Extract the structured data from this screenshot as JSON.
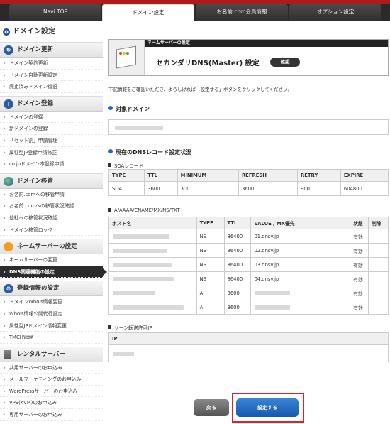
{
  "tabs": [
    {
      "label": "Navi TOP"
    },
    {
      "label": "ドメイン設定"
    },
    {
      "label": "お名前.com会員情報"
    },
    {
      "label": "オプション設定"
    }
  ],
  "sidebar": {
    "title": "ドメイン設定",
    "sections": [
      {
        "title": "ドメイン更新",
        "icon": "refresh-icon",
        "items": [
          "ドメイン契約更新",
          "ドメイン自動更新設定",
          "廃止済みドメイン復旧"
        ]
      },
      {
        "title": "ドメイン登録",
        "icon": "plus-icon",
        "items": [
          "ドメインの登録",
          "新ドメインの登録",
          "「セット割」申請管理",
          "属性型JP登録申請修正",
          "co.jpドメイン本登録申請"
        ]
      },
      {
        "title": "ドメイン移管",
        "icon": "globe-icon",
        "items": [
          "お名前.comへの移管申請",
          "お名前.comへの移管状況確認",
          "他社への移管状況確認",
          "ドメイン移管ロック"
        ]
      },
      {
        "title": "ネームサーバーの設定",
        "icon": "user-icon",
        "items": [
          "ネームサーバーの変更",
          "DNS関連機能の設定"
        ]
      },
      {
        "title": "登録情報の設定",
        "icon": "settings-icon",
        "items": [
          "ドメインWhois情報変更",
          "Whois情報公開代行設定",
          "属性型JPドメイン情報変更",
          "TMCH管理"
        ]
      },
      {
        "title": "レンタルサーバー",
        "icon": "server-icon",
        "items": [
          "共用サーバーのお申込み",
          "メールマーケティングのお申込み",
          "WordPressサーバーのお申込み",
          "VPS(KVM)のお申込み",
          "専用サーバーのお申込み"
        ]
      }
    ]
  },
  "header": {
    "strip": "ネームサーバーの設定",
    "title": "セカンダリDNS(Master) 設定",
    "badge": "確認"
  },
  "instruction": "下記情報をご確認いただき、よろしければ「設定する」ボタンをクリックしてください。",
  "target_domain_heading": "対象ドメイン",
  "current_heading": "現在のDNSレコード設定状況",
  "soa": {
    "label": "SOAレコード",
    "headers": [
      "TYPE",
      "TTL",
      "MINIMUM",
      "REFRESH",
      "RETRY",
      "EXPIRE"
    ],
    "row": [
      "SOA",
      "3600",
      "300",
      "3600",
      "900",
      "604800"
    ]
  },
  "records": {
    "label": "A/AAAA/CNAME/MX/NS/TXT",
    "headers": [
      "ホスト名",
      "TYPE",
      "TTL",
      "VALUE / MX優先",
      "状態",
      "削除"
    ],
    "rows": [
      [
        "",
        "NS",
        "86400",
        "01.dnsv.jp",
        "有効",
        ""
      ],
      [
        "",
        "NS",
        "86400",
        "02.dnsv.jp",
        "有効",
        ""
      ],
      [
        "",
        "NS",
        "86400",
        "03.dnsv.jp",
        "有効",
        ""
      ],
      [
        "",
        "NS",
        "86400",
        "04.dnsv.jp",
        "有効",
        ""
      ],
      [
        "",
        "A",
        "3600",
        "",
        "有効",
        ""
      ],
      [
        "",
        "A",
        "3600",
        "",
        "有効",
        ""
      ]
    ]
  },
  "zone": {
    "label": "ゾーン転送許可IP",
    "header": "IP"
  },
  "buttons": {
    "back": "戻る",
    "submit": "設定する"
  }
}
